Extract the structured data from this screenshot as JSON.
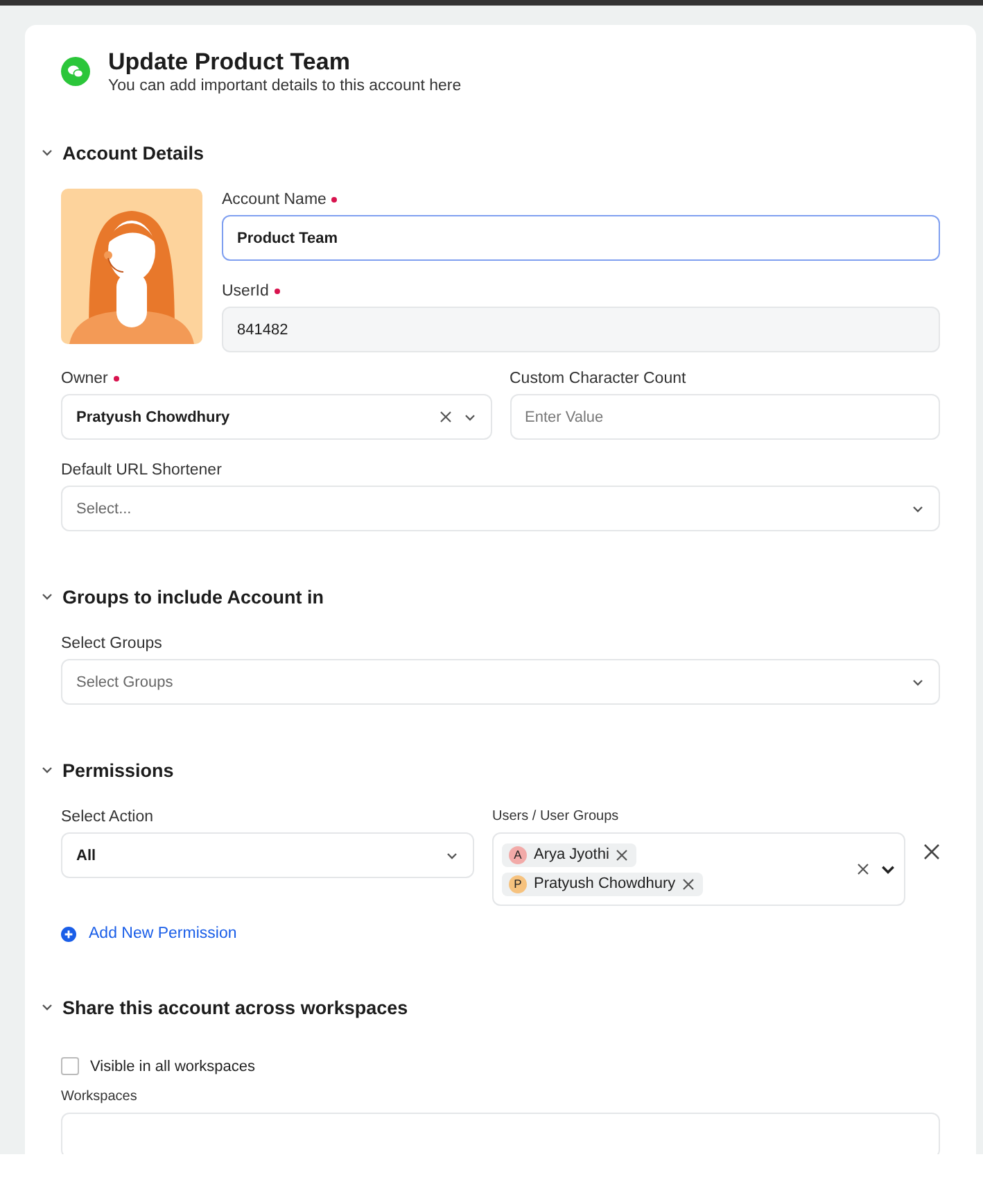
{
  "header": {
    "title": "Update Product Team",
    "subtitle": "You can add important details to this account here"
  },
  "account_details": {
    "title": "Account Details",
    "expanded": true,
    "account_name": {
      "label": "Account Name",
      "required": true,
      "value": "Product Team",
      "focused": true
    },
    "user_id": {
      "label": "UserId",
      "required": true,
      "value": "841482",
      "disabled": true
    },
    "owner": {
      "label": "Owner",
      "required": true,
      "value": "Pratyush Chowdhury"
    },
    "custom_character_count": {
      "label": "Custom Character Count",
      "placeholder": "Enter Value"
    },
    "default_url_shortener": {
      "label": "Default URL Shortener",
      "placeholder": "Select..."
    }
  },
  "groups": {
    "title": "Groups to include Account in",
    "expanded": true,
    "select_groups": {
      "label": "Select Groups",
      "placeholder": "Select Groups"
    }
  },
  "permissions": {
    "title": "Permissions",
    "expanded": true,
    "rows": [
      {
        "action_label": "Select Action",
        "action_value": "All",
        "users_label": "Users / User Groups",
        "users": [
          {
            "initial": "A",
            "name": "Arya Jyothi",
            "color": "#f2aaa8"
          },
          {
            "initial": "P",
            "name": "Pratyush Chowdhury",
            "color": "#f6c27e"
          }
        ]
      }
    ],
    "add_button": "Add New Permission"
  },
  "share": {
    "title": "Share this account across workspaces",
    "expanded": true,
    "visible_all": {
      "label": "Visible in all workspaces",
      "checked": false
    },
    "workspaces": {
      "label": "Workspaces"
    }
  }
}
